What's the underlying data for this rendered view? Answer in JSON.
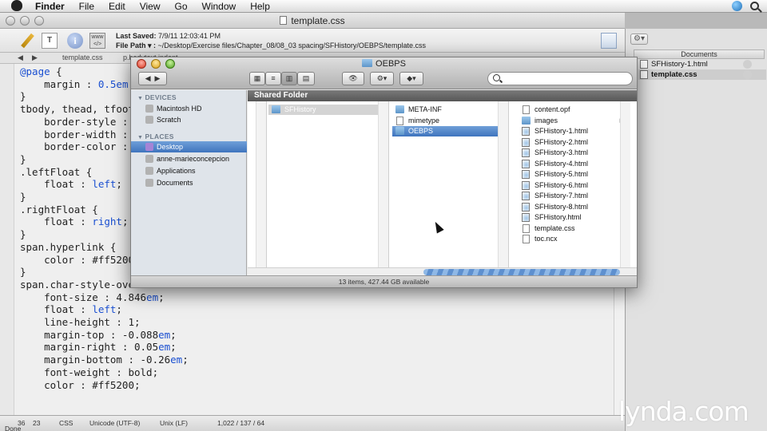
{
  "menubar": {
    "app": "Finder",
    "menus": [
      "File",
      "Edit",
      "View",
      "Go",
      "Window",
      "Help"
    ]
  },
  "editor": {
    "title": "template.css",
    "last_saved_label": "Last Saved:",
    "last_saved": "7/9/11 12:03:41 PM",
    "file_path_label": "File Path ▾ :",
    "file_path": "~/Desktop/Exercise files/Chapter_08/08_03 spacing/SFHistory/OEBPS/template.css",
    "tab_name": "template.css",
    "tab_name_2": "p.bodytext.indent",
    "status": {
      "line": "36",
      "col": "23",
      "syntax": "CSS",
      "encoding": "Unicode (UTF-8)",
      "line_endings": "Unix (LF)",
      "counts": "1,022 / 137 / 64",
      "done": "Done"
    }
  },
  "code": {
    "l1a": "@page",
    "l1b": " {",
    "l2a": "    margin : ",
    "l2b": "0.5",
    "l2c": "em",
    "l2d": ";",
    "l3": "}",
    "l4": "tbody, thead, tfoot",
    "l5a": "    border-style : ",
    "l6a": "    border-width : ",
    "l7a": "    border-color : ",
    "l8": "}",
    "l9": ".leftFloat {",
    "l10a": "    float : ",
    "l10b": "left",
    "l10c": ";",
    "l11": "}",
    "l12": ".rightFloat {",
    "l13a": "    float : ",
    "l13b": "right",
    "l13c": ";",
    "l14": "}",
    "l15": "span.hyperlink {",
    "l16a": "    color : ",
    "l16b": "#ff5200",
    "l17": "}",
    "l18": "span.char-style-over",
    "l19a": "    font-size : 4.846",
    "l19b": "em",
    "l19c": ";",
    "l20a": "    float : ",
    "l20b": "left",
    "l20c": ";",
    "l21": "    line-height : 1;",
    "l22a": "    margin-top : -0.088",
    "l22b": "em",
    "l22c": ";",
    "l23a": "    margin-right : 0.05",
    "l23b": "em",
    "l23c": ";",
    "l24a": "    margin-bottom : -0.26",
    "l24b": "em",
    "l24c": ";",
    "l25": "    font-weight : bold;",
    "l26": "    color : #ff5200;"
  },
  "documents": {
    "header": "Documents",
    "items": [
      {
        "name": "SFHistory-1.html",
        "selected": false
      },
      {
        "name": "template.css",
        "selected": true
      }
    ]
  },
  "watermark": "lynda.com",
  "finder": {
    "title": "OEBPS",
    "search_placeholder": "",
    "sidebar": {
      "devices_label": "DEVICES",
      "devices": [
        "Macintosh HD",
        "Scratch"
      ],
      "places_label": "PLACES",
      "places": [
        "Desktop",
        "anne-marieconcepcion",
        "Applications",
        "Documents"
      ],
      "selected": "Desktop"
    },
    "path_header": "Shared Folder",
    "col1": [
      {
        "name": "SFHistory",
        "type": "folder",
        "selected": true
      }
    ],
    "col2": [
      {
        "name": "META-INF",
        "type": "folder"
      },
      {
        "name": "mimetype",
        "type": "file"
      },
      {
        "name": "OEBPS",
        "type": "folder",
        "selected": true
      }
    ],
    "col3": [
      {
        "name": "content.opf",
        "type": "file"
      },
      {
        "name": "images",
        "type": "folder"
      },
      {
        "name": "SFHistory-1.html",
        "type": "html"
      },
      {
        "name": "SFHistory-2.html",
        "type": "html"
      },
      {
        "name": "SFHistory-3.html",
        "type": "html"
      },
      {
        "name": "SFHistory-4.html",
        "type": "html"
      },
      {
        "name": "SFHistory-5.html",
        "type": "html"
      },
      {
        "name": "SFHistory-6.html",
        "type": "html"
      },
      {
        "name": "SFHistory-7.html",
        "type": "html"
      },
      {
        "name": "SFHistory-8.html",
        "type": "html"
      },
      {
        "name": "SFHistory.html",
        "type": "html"
      },
      {
        "name": "template.css",
        "type": "file"
      },
      {
        "name": "toc.ncx",
        "type": "file"
      }
    ],
    "status": "13 items, 427.44 GB available"
  },
  "colors": {
    "selection": "#3f74be",
    "code_keyword": "#1a4fd1"
  }
}
